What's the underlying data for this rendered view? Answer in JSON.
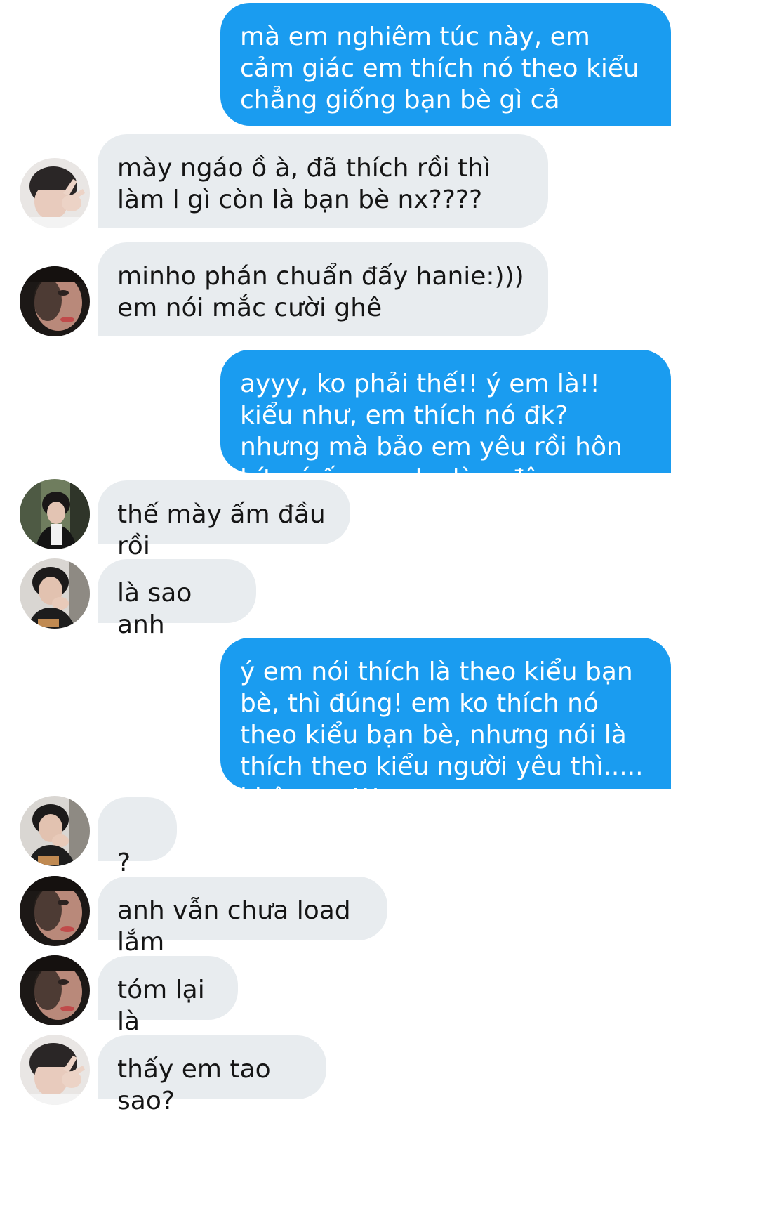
{
  "messages": [
    {
      "from": "me",
      "text": "mà em nghiêm túc này, em cảm giác em thích nó theo kiểu chẳng giống bạn bè gì cả"
    },
    {
      "from": "other",
      "avatar": "avatar-peace-sign",
      "text": "mày ngáo ồ à, đã thích rồi thì làm l gì còn là bạn bè nx????"
    },
    {
      "from": "other",
      "avatar": "avatar-hooded-closeup",
      "text": "minho phán chuẩn đấy hanie:))) em nói mắc cười ghê"
    },
    {
      "from": "me",
      "text": "ayyy, ko phải thế!! ý em là!! kiểu như, em thích nó đk? nhưng mà bảo em yêu rồi hôn hít nó ấy, em ko làm đâu"
    },
    {
      "from": "other",
      "avatar": "avatar-dark-hair-green-bg",
      "text": "thế mày ấm đầu rồi"
    },
    {
      "from": "other",
      "avatar": "avatar-hand-on-chin",
      "text": "là sao anh"
    },
    {
      "from": "me",
      "text": "ý em nói thích là theo kiểu bạn bè, thì đúng! em ko thích nó theo kiểu bạn bè, nhưng nói là thích theo kiểu người yêu thì..... khônggg!!!"
    },
    {
      "from": "other",
      "avatar": "avatar-hand-on-chin",
      "text": "?",
      "emoji": "smiling-face-emoji"
    },
    {
      "from": "other",
      "avatar": "avatar-hooded-closeup",
      "text": "anh vẫn chưa load lắm"
    },
    {
      "from": "other",
      "avatar": "avatar-hooded-closeup",
      "text": "tóm lại là"
    },
    {
      "from": "other",
      "avatar": "avatar-peace-sign",
      "text": "thấy em tao sao?"
    }
  ],
  "colors": {
    "sent_bubble": "#1a9cf0",
    "sent_text": "#ffffff",
    "received_bubble": "#e8ecef",
    "received_text": "#151515"
  }
}
